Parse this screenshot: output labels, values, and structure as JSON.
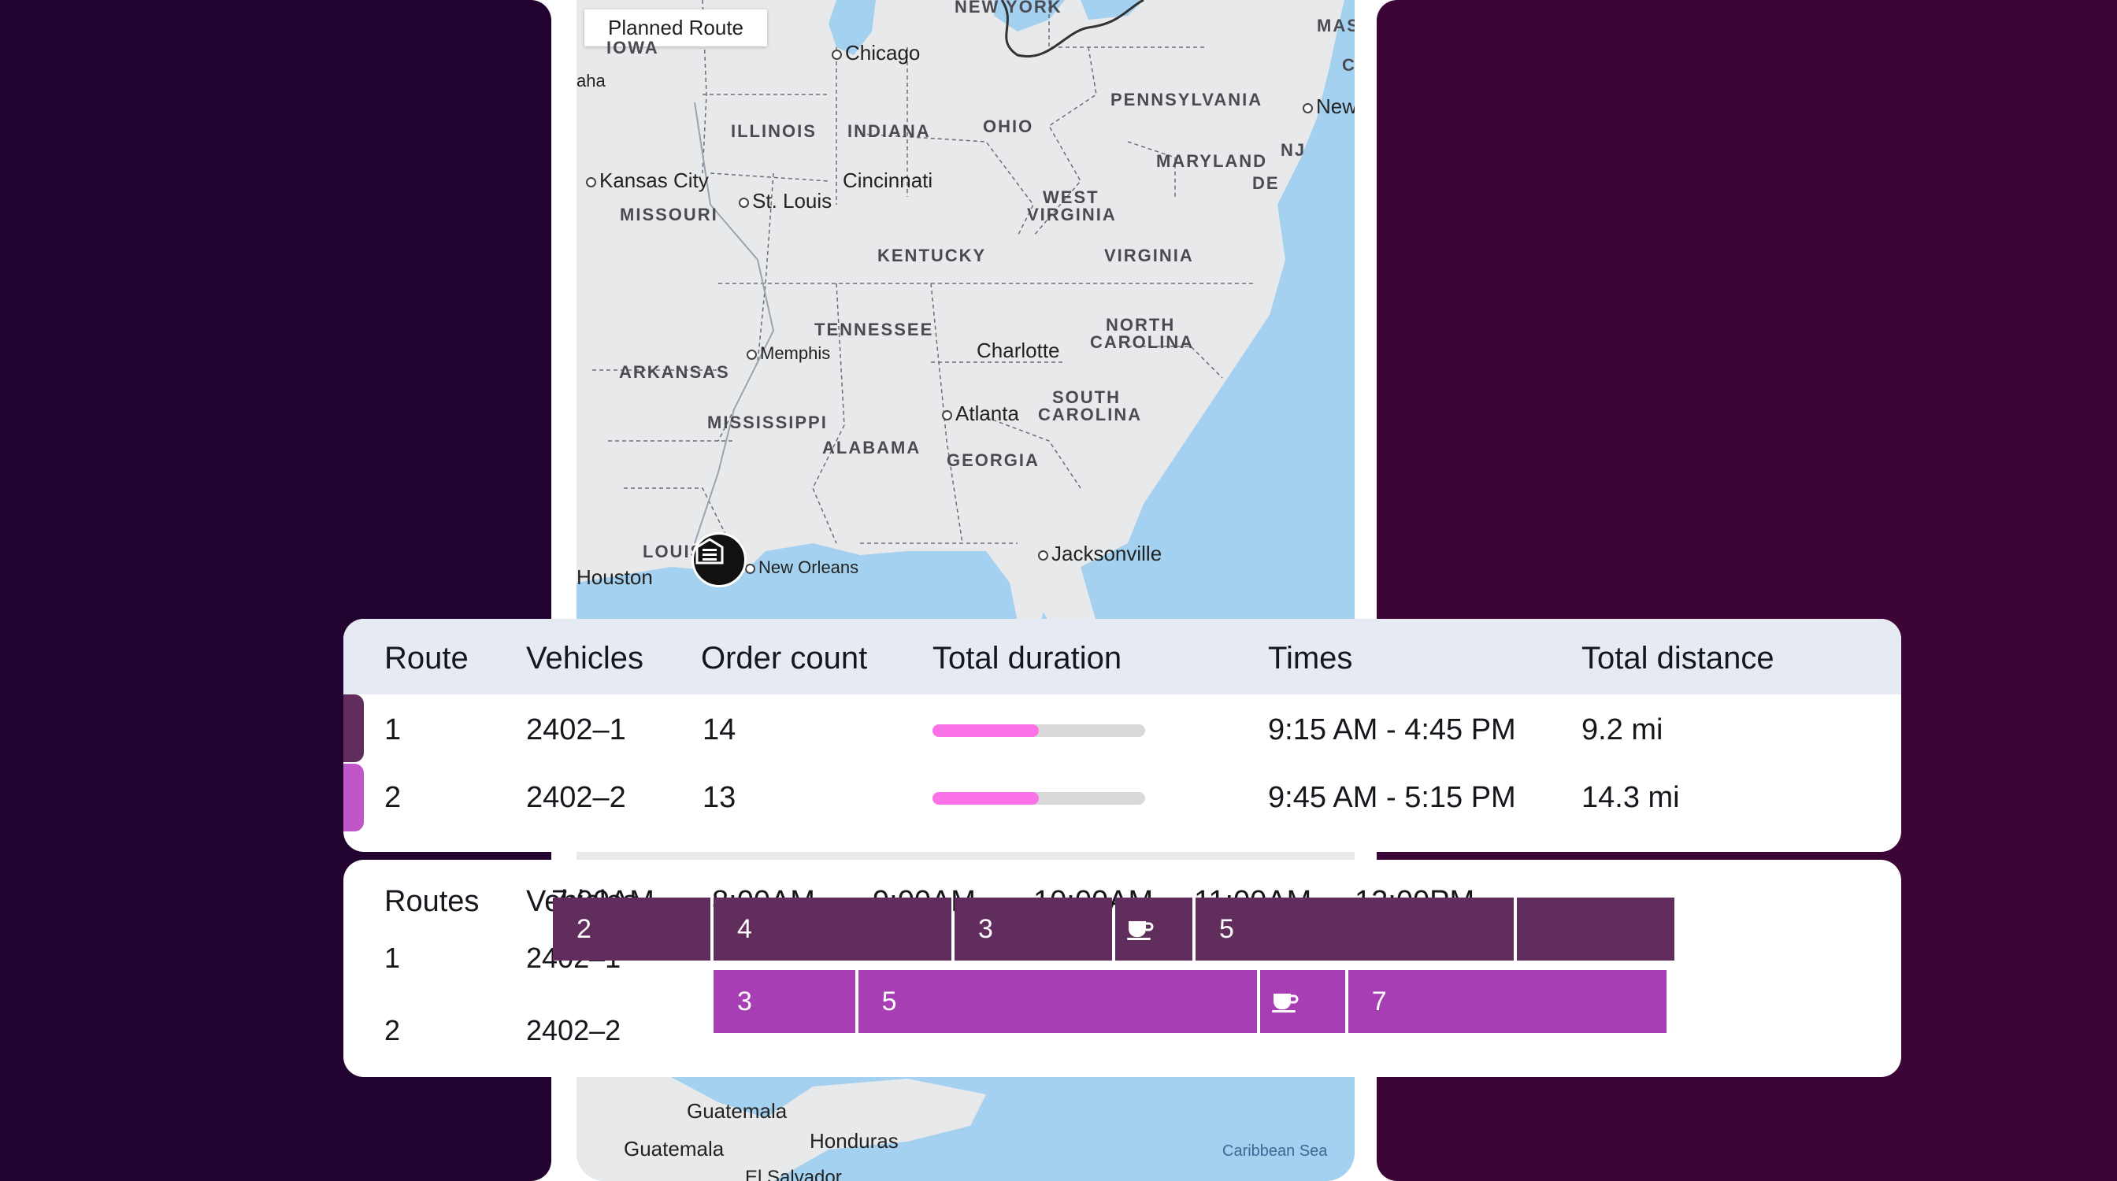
{
  "colors": {
    "background_left": "#22022e",
    "background_right": "#3b0536",
    "route_1": "#602d5c",
    "route_2": "#a83eb4",
    "duration_fill": "#fb72e8",
    "water": "#a3d1ef",
    "land": "#e8e9ea"
  },
  "map": {
    "chip_label": "Planned Route",
    "states": [
      "NEW YORK",
      "MAS",
      "PENNSYLVANIA",
      "NJ",
      "MARYLAND",
      "DE",
      "OHIO",
      "ILLINOIS",
      "INDIANA",
      "WEST VIRGINIA",
      "VIRGINIA",
      "KENTUCKY",
      "MISSOURI",
      "TENNESSEE",
      "NORTH CAROLINA",
      "ARKANSAS",
      "SOUTH CAROLINA",
      "MISSISSIPPI",
      "ALABAMA",
      "GEORGIA",
      "LOUIS",
      "IOWA",
      "C"
    ],
    "cities": [
      "Chicago",
      "New",
      "Kansas City",
      "St. Louis",
      "Cincinnati",
      "Charlotte",
      "Memphis",
      "Atlanta",
      "Jacksonville",
      "New Orleans",
      "Houston",
      "aha",
      "Guatemala",
      "Honduras",
      "El Salvador"
    ],
    "labels": {
      "new_york": "NEW YORK",
      "mas": "MAS",
      "c": "C",
      "pennsylvania": "PENNSYLVANIA",
      "nj": "NJ",
      "maryland": "MARYLAND",
      "de": "DE",
      "ohio": "OHIO",
      "illinois": "ILLINOIS",
      "indiana": "INDIANA",
      "west": "WEST",
      "virginia_w": "VIRGINIA",
      "virginia": "VIRGINIA",
      "kentucky": "KENTUCKY",
      "missouri": "MISSOURI",
      "iowa": "IOWA",
      "tennessee": "TENNESSEE",
      "north": "NORTH",
      "carolina_n": "CAROLINA",
      "arkansas": "ARKANSAS",
      "south": "SOUTH",
      "carolina_s": "CAROLINA",
      "mississippi": "MISSISSIPPI",
      "alabama": "ALABAMA",
      "georgia": "GEORGIA",
      "louis": "LOUIS",
      "chicago": "Chicago",
      "new": "New",
      "omaha": "aha",
      "kansas_city": "Kansas City",
      "st_louis": "St. Louis",
      "cincinnati": "Cincinnati",
      "charlotte": "Charlotte",
      "memphis": "Memphis",
      "atlanta": "Atlanta",
      "jacksonville": "Jacksonville",
      "new_orleans": "New Orleans",
      "houston": "Houston",
      "guatemala_region": "Guatemala",
      "guatemala_city": "Guatemala",
      "honduras": "Honduras",
      "el_salvador": "El Salvador",
      "caribbean_sea": "Caribbean Sea"
    },
    "depot_icon": "warehouse-icon"
  },
  "summary": {
    "headers": {
      "route": "Route",
      "vehicles": "Vehicles",
      "order_count": "Order count",
      "total_duration": "Total duration",
      "times": "Times",
      "total_distance": "Total distance"
    },
    "rows": [
      {
        "route": "1",
        "vehicle": "2402–1",
        "orders": "14",
        "duration_fraction": 0.5,
        "times": "9:15 AM - 4:45 PM",
        "distance": "9.2 mi"
      },
      {
        "route": "2",
        "vehicle": "2402–2",
        "orders": "13",
        "duration_fraction": 0.5,
        "times": "9:45 AM - 5:15 PM",
        "distance": "14.3 mi"
      }
    ]
  },
  "schedule": {
    "headers": {
      "routes": "Routes",
      "vehicles": "Vehicles",
      "hours": [
        "7:00AM",
        "8:00AM",
        "9:00AM",
        "10:00AM",
        "11:00AM",
        "12:00PM"
      ]
    },
    "rows": [
      {
        "route": "1",
        "vehicle": "2402–1",
        "segments": [
          {
            "label": "2",
            "start_hour": 7.0,
            "end_hour": 8.0
          },
          {
            "label": "4",
            "start_hour": 8.0,
            "end_hour": 9.5
          },
          {
            "label": "3",
            "start_hour": 9.5,
            "end_hour": 10.5
          },
          {
            "label": "",
            "break": true,
            "icon": "coffee-cup-icon",
            "start_hour": 10.5,
            "end_hour": 11.0
          },
          {
            "label": "5",
            "start_hour": 11.0,
            "end_hour": 13.0
          },
          {
            "label": "",
            "start_hour": 13.0,
            "end_hour": 14.0
          }
        ]
      },
      {
        "route": "2",
        "vehicle": "2402–2",
        "segments": [
          {
            "label": "3",
            "start_hour": 8.0,
            "end_hour": 8.9
          },
          {
            "label": "5",
            "start_hour": 8.9,
            "end_hour": 11.4
          },
          {
            "label": "",
            "break": true,
            "icon": "coffee-cup-icon",
            "start_hour": 11.4,
            "end_hour": 11.95
          },
          {
            "label": "7",
            "start_hour": 11.95,
            "end_hour": 13.95
          }
        ]
      }
    ]
  }
}
